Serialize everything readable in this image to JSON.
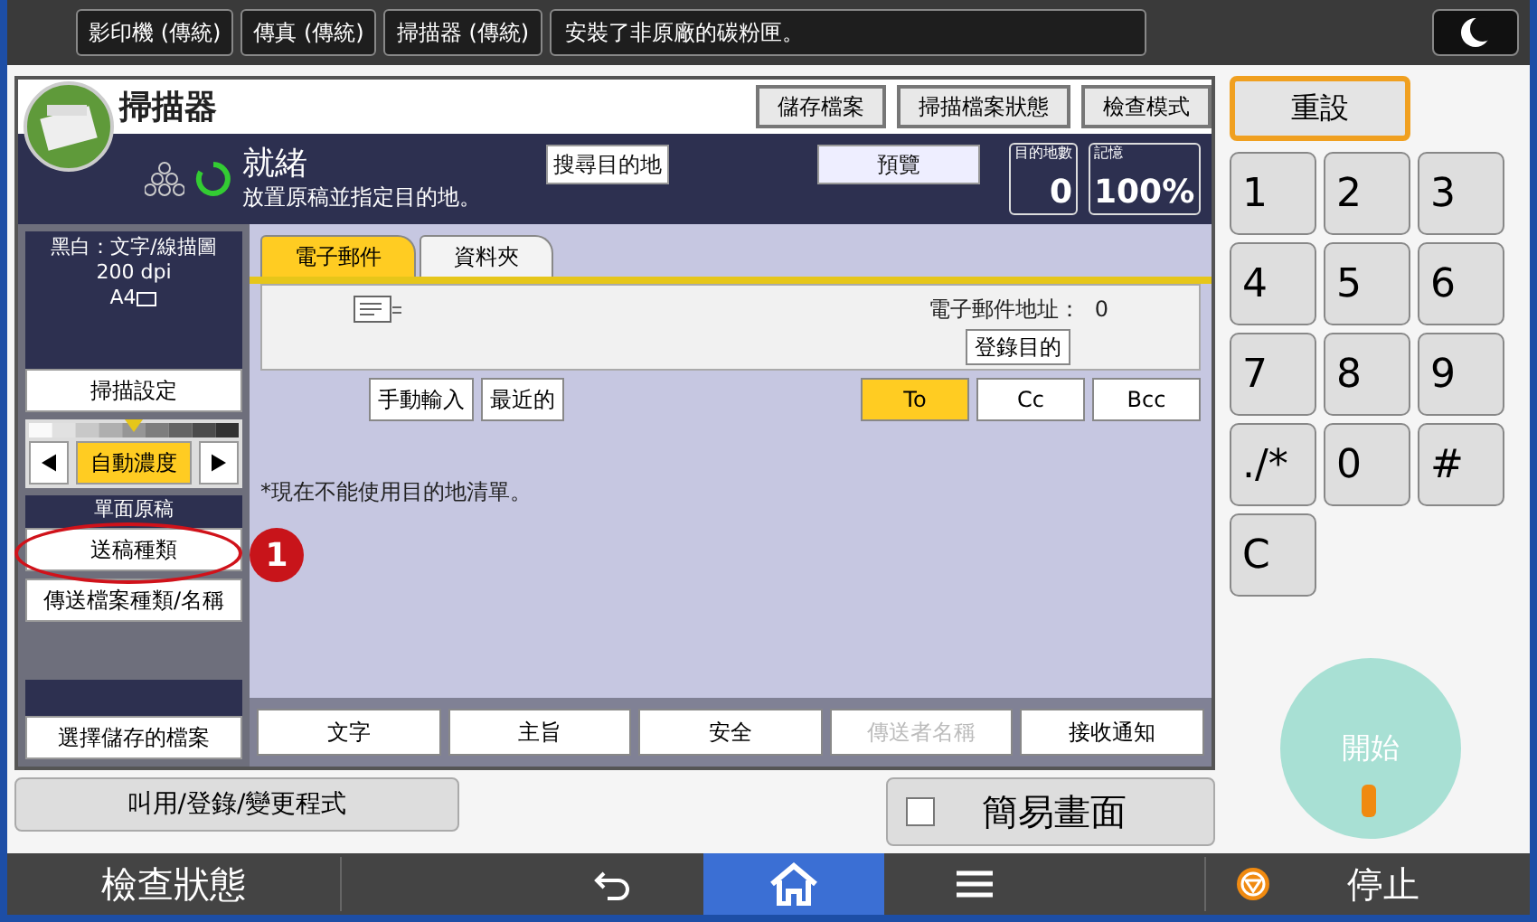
{
  "top_bar": {
    "apps": [
      {
        "label": "影印機 (傳統)"
      },
      {
        "label": "傳真 (傳統)"
      },
      {
        "label": "掃描器 (傳統)"
      }
    ],
    "message": "安裝了非原廠的碳粉匣。"
  },
  "scanner": {
    "title": "掃描器",
    "header_buttons": [
      "儲存檔案",
      "掃描檔案狀態",
      "檢查模式"
    ],
    "status": "就緒",
    "instruction": "放置原稿並指定目的地。",
    "search_button": "搜尋目的地",
    "preview_button": "預覽",
    "dest_count": {
      "label": "目的地數",
      "value": "0"
    },
    "memory": {
      "label": "記憶",
      "value": "100%"
    }
  },
  "settings": {
    "summary": [
      "黑白：文字/線描圖",
      "200 dpi",
      "A4"
    ],
    "scan_settings": "掃描設定",
    "density": {
      "level": 0.5,
      "label": "自動濃度"
    },
    "original_label": "單面原稿",
    "original_type": "送稿種類",
    "file_type": "傳送檔案種類/名稱",
    "stored_file": "選擇儲存的檔案"
  },
  "tabs": [
    {
      "label": "電子郵件",
      "selected": true
    },
    {
      "label": "資料夾",
      "selected": false
    }
  ],
  "email_address": {
    "label": "電子郵件地址：",
    "count": "0"
  },
  "register_button": "登錄目的",
  "entry_buttons": [
    "手動輸入",
    "最近的"
  ],
  "recipient_types": [
    {
      "label": "To",
      "selected": true
    },
    {
      "label": "Cc",
      "selected": false
    },
    {
      "label": "Bcc",
      "selected": false
    }
  ],
  "notice": "*現在不能使用目的地清單。",
  "option_buttons": [
    {
      "label": "文字",
      "disabled": false
    },
    {
      "label": "主旨",
      "disabled": false
    },
    {
      "label": "安全",
      "disabled": false
    },
    {
      "label": "傳送者名稱",
      "disabled": true
    },
    {
      "label": "接收通知",
      "disabled": false
    }
  ],
  "callout": "1",
  "program_button": "叫用/登錄/變更程式",
  "simple_screen": {
    "label": "簡易畫面",
    "checked": false
  },
  "reset_button": "重設",
  "keypad": [
    "1",
    "2",
    "3",
    "4",
    "5",
    "6",
    "7",
    "8",
    "9",
    "./*",
    "0",
    "#",
    "C"
  ],
  "start_button": "開始",
  "bottom_bar": {
    "status": "檢查狀態",
    "stop": "停止"
  }
}
